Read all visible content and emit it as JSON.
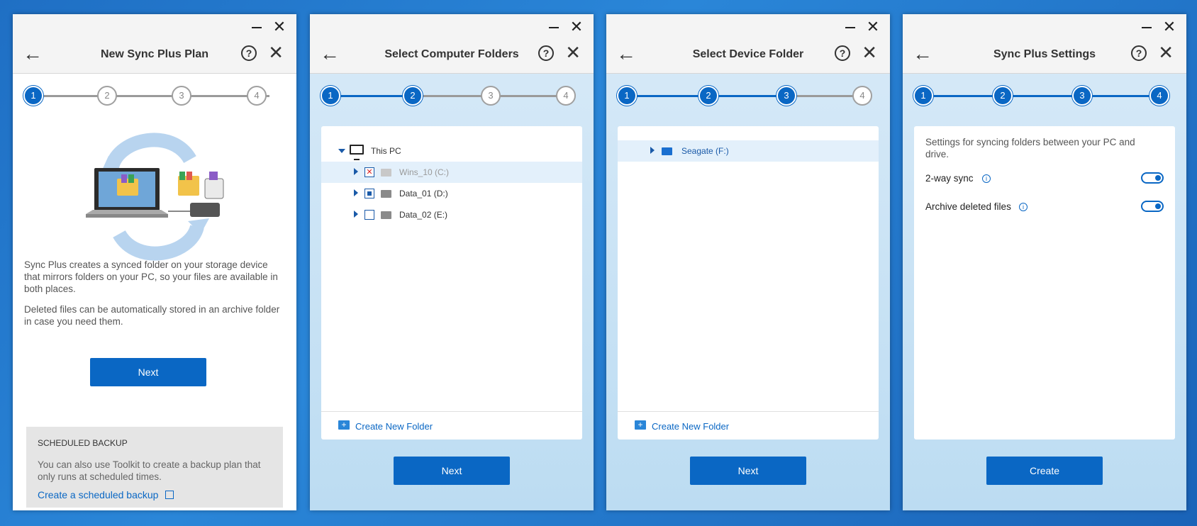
{
  "panels": [
    {
      "title": "New Sync Plus Plan",
      "steps": [
        "1",
        "2",
        "3",
        "4"
      ],
      "active_steps": 1,
      "desc1": "Sync Plus creates a synced folder on your storage device that mirrors folders on your PC, so your files are available in both places.",
      "desc2": "Deleted files can be automatically stored in an archive folder in case you need them.",
      "next_label": "Next",
      "scheduled": {
        "heading": "SCHEDULED BACKUP",
        "text": "You can also use Toolkit to create a backup plan that only runs at scheduled times.",
        "link": "Create a scheduled backup"
      }
    },
    {
      "title": "Select Computer Folders",
      "steps": [
        "1",
        "2",
        "3",
        "4"
      ],
      "active_steps": 2,
      "tree": {
        "root": "This PC",
        "drives": [
          {
            "label": "Wins_10 (C:)",
            "check": "excluded",
            "selected": true
          },
          {
            "label": "Data_01 (D:)",
            "check": "partial",
            "selected": false
          },
          {
            "label": "Data_02 (E:)",
            "check": "unchecked",
            "selected": false
          }
        ]
      },
      "create_folder": "Create New Folder",
      "next_label": "Next"
    },
    {
      "title": "Select Device Folder",
      "steps": [
        "1",
        "2",
        "3",
        "4"
      ],
      "active_steps": 3,
      "device": {
        "label": "Seagate (F:)"
      },
      "create_folder": "Create New Folder",
      "next_label": "Next"
    },
    {
      "title": "Sync Plus Settings",
      "steps": [
        "1",
        "2",
        "3",
        "4"
      ],
      "active_steps": 4,
      "intro": "Settings for syncing folders between your PC and drive.",
      "settings": [
        {
          "label": "2-way sync",
          "enabled": true
        },
        {
          "label": "Archive deleted files",
          "enabled": true
        }
      ],
      "create_label": "Create"
    }
  ],
  "colors": {
    "accent": "#0a67c4",
    "step_inactive": "#9a9a9a"
  },
  "icons": {
    "back": "arrow-left-icon",
    "help": "help-circle-icon",
    "close": "close-icon",
    "minimize": "minimize-icon"
  }
}
